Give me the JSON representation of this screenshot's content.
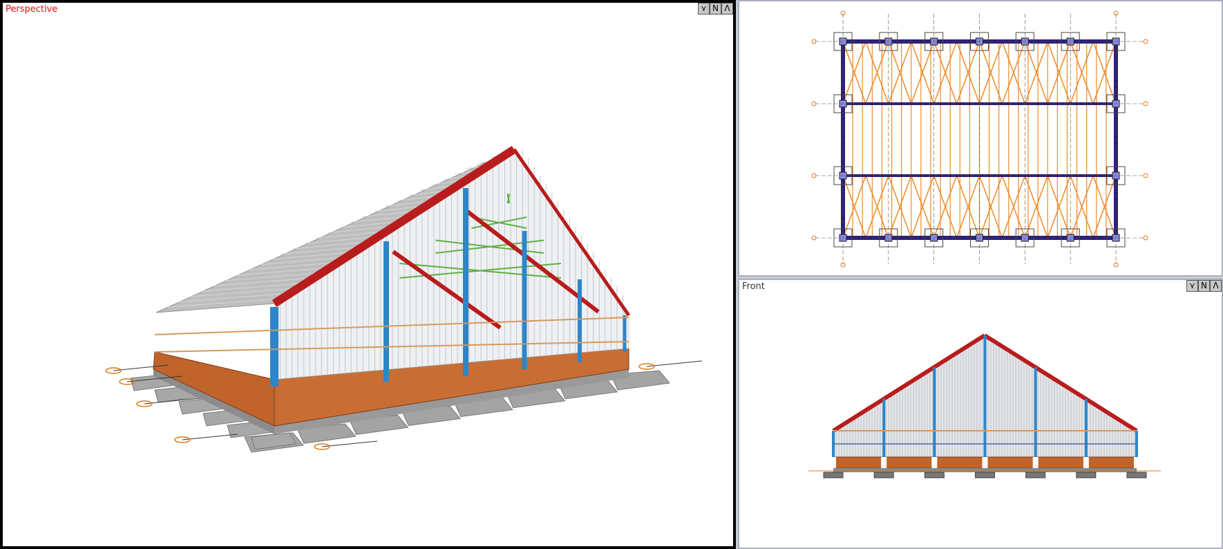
{
  "viewports": {
    "perspective": {
      "label": "Perspective",
      "label_color": "#e01010"
    },
    "plan": {
      "label": ""
    },
    "front": {
      "label": "Front"
    }
  },
  "view_buttons": {
    "filter": "⋎",
    "north": "N",
    "maximize": "Λ"
  },
  "colors": {
    "column": "#2e86c8",
    "rafter": "#b81c1c",
    "brick": "#c0642c",
    "bracing_plan": "#f08a28",
    "bracing_3d": "#5cb040",
    "frame_plan": "#2a1e78",
    "footing": "#9a9a9a",
    "roof": "#b8b8b8"
  }
}
